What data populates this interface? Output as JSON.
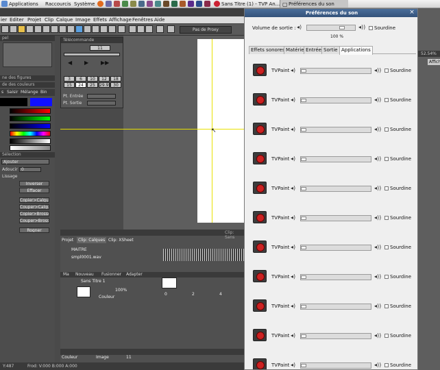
{
  "system_panel": {
    "menu_applications": "Applications",
    "menu_shortcuts": "Raccourcis",
    "menu_system": "Système",
    "task_1": "Sans Titre (1) - TVP An...",
    "task_2": "Préférences du son"
  },
  "tvp_menu": [
    "ier",
    "Editer",
    "Projet",
    "Clip",
    "Calque",
    "Image",
    "Effets",
    "Affichage",
    "Fenêtres",
    "Aide"
  ],
  "toolbar": {
    "proxy_label": "Pas de Proxy"
  },
  "left_panel": {
    "panel_top_label": "pel",
    "swatch_label_1": "ne des figures",
    "swatch_label_2": "de des couleurs",
    "tabs": [
      "s",
      "Saisir",
      "Mélange",
      "Bin"
    ],
    "selection_title": "Sélection",
    "mode_value": "Ajouter",
    "adoucir_label": "Adoucir",
    "adoucir_value": "0",
    "lissage_label": "Lissage",
    "buttons": [
      "Inverser",
      "Effacer",
      "Copier>Calque",
      "Couper>Calque",
      "Copier>Brosse",
      "Couper>Brosse",
      "Rogner"
    ]
  },
  "transport": {
    "title": "Télécommande",
    "frame_value": "11",
    "fps_row1": [
      "3",
      "6",
      "10",
      "12",
      "18"
    ],
    "fps_row2": [
      "15",
      "24",
      "25",
      "29.97",
      "30"
    ],
    "in_label": "Pt. Entrée",
    "out_label": "Pt. Sortie"
  },
  "timeline": {
    "clip_label": "Clip: Sans",
    "tabs": [
      "Projet",
      "Clip: Calques",
      "Clip: XSheet"
    ],
    "track_1": "MAITRE",
    "track_2": "smpl0001.wav",
    "header_labels": [
      "Ma",
      "Nouveau",
      "Fusionner",
      "Adapter"
    ],
    "layer_name": "Sans Titre 1",
    "opacity": "100%",
    "blend": "Couleur",
    "ruler": [
      "0",
      "2",
      "4"
    ],
    "bottom_left": "Couleur",
    "bottom_mid": "Image",
    "bottom_value": "11"
  },
  "status_bar": {
    "coords": "Y:487",
    "frame_info": "Frod: V:000 B:000 A:000"
  },
  "right_strip": {
    "zoom": "52.54%",
    "view_btn": "Affich"
  },
  "dialog": {
    "title": "Préférences du son",
    "output_volume_label": "Volume de sortie :",
    "output_volume_value": "100 %",
    "output_volume_level": 0.78,
    "mute_label": "Sourdine",
    "tabs": [
      "Effets sonores",
      "Matériel",
      "Entrée",
      "Sortie",
      "Applications"
    ],
    "active_tab": "Applications",
    "applications": [
      {
        "name": "TVPaint",
        "mute": "Sourdine",
        "level": 0.0
      },
      {
        "name": "TVPaint",
        "mute": "Sourdine",
        "level": 0.0
      },
      {
        "name": "TVPaint",
        "mute": "Sourdine",
        "level": 0.0
      },
      {
        "name": "TVPaint",
        "mute": "Sourdine",
        "level": 0.0
      },
      {
        "name": "TVPaint",
        "mute": "Sourdine",
        "level": 0.0
      },
      {
        "name": "TVPaint",
        "mute": "Sourdine",
        "level": 0.0
      },
      {
        "name": "TVPaint",
        "mute": "Sourdine",
        "level": 0.0
      },
      {
        "name": "TVPaint",
        "mute": "Sourdine",
        "level": 0.0
      },
      {
        "name": "TVPaint",
        "mute": "Sourdine",
        "level": 0.0
      },
      {
        "name": "TVPaint",
        "mute": "Sourdine",
        "level": 0.0
      },
      {
        "name": "TVPaint",
        "mute": "Sourdine",
        "level": 0.0
      }
    ]
  },
  "colors": {
    "accent": "#3a5a8a",
    "guide": "#e8e000"
  }
}
